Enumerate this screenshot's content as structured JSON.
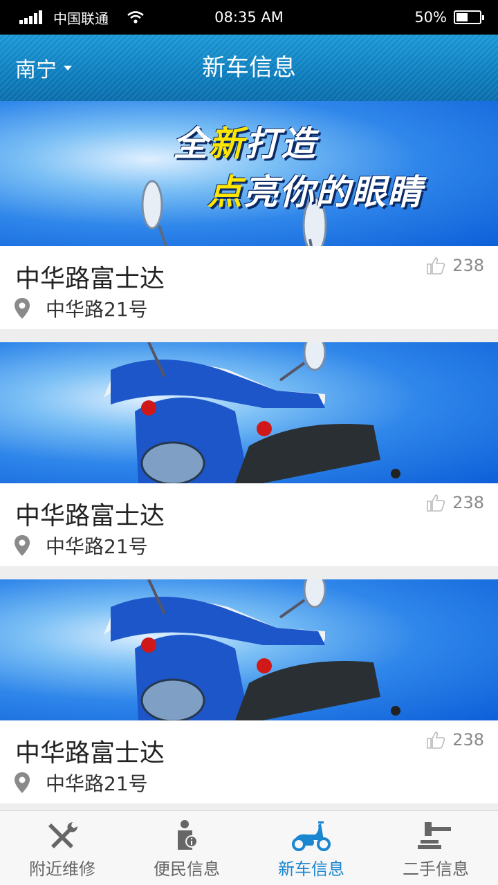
{
  "status_bar": {
    "carrier": "中国联通",
    "time": "08:35 AM",
    "battery_text": "50%",
    "battery_level": 0.5
  },
  "header": {
    "city": "南宁",
    "title": "新车信息"
  },
  "banner_slogan": {
    "line1_a": "全",
    "line1_hl": "新",
    "line1_b": "打造",
    "line2_hl": "点",
    "line2_b": "亮你的眼睛"
  },
  "listings": [
    {
      "name": "中华路富士达",
      "address": "中华路21号",
      "likes": "238"
    },
    {
      "name": "中华路富士达",
      "address": "中华路21号",
      "likes": "238"
    },
    {
      "name": "中华路富士达",
      "address": "中华路21号",
      "likes": "238"
    }
  ],
  "tabs": [
    {
      "label": "附近维修",
      "icon": "repair-tools-icon"
    },
    {
      "label": "便民信息",
      "icon": "info-person-icon"
    },
    {
      "label": "新车信息",
      "icon": "scooter-icon",
      "active": true
    },
    {
      "label": "二手信息",
      "icon": "gavel-icon"
    }
  ],
  "colors": {
    "accent": "#1a86d0",
    "header_bg": "#0d7fc0",
    "inactive": "#666666"
  }
}
